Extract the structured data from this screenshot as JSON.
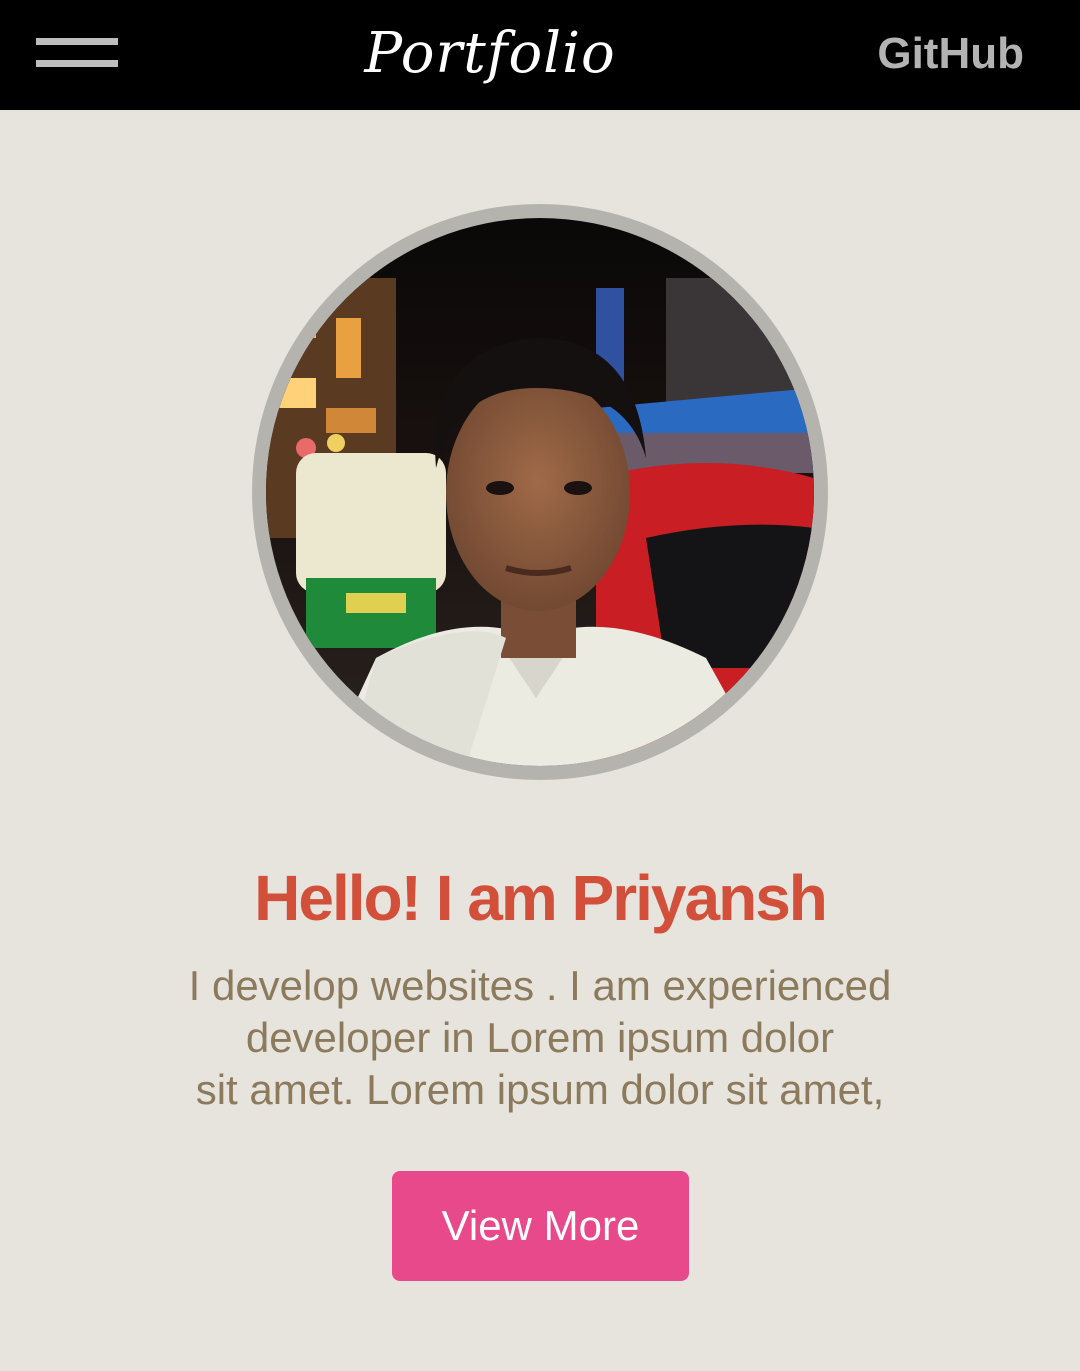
{
  "header": {
    "brand": "Portfolio",
    "github_label": "GitHub",
    "menu_icon": "hamburger-menu-icon"
  },
  "hero": {
    "avatar": "profile-photo",
    "title": "Hello! I am Priyansh",
    "description_lines": [
      "I develop websites . I am experienced",
      "developer in Lorem ipsum dolor",
      "sit amet. Lorem ipsum dolor sit amet,"
    ],
    "cta_label": "View More"
  },
  "colors": {
    "header_bg": "#000000",
    "page_bg": "#e7e4de",
    "title": "#d2503a",
    "body_text": "#8c7a5c",
    "button_bg": "#e8498a",
    "nav_link": "#b3b3b3"
  }
}
